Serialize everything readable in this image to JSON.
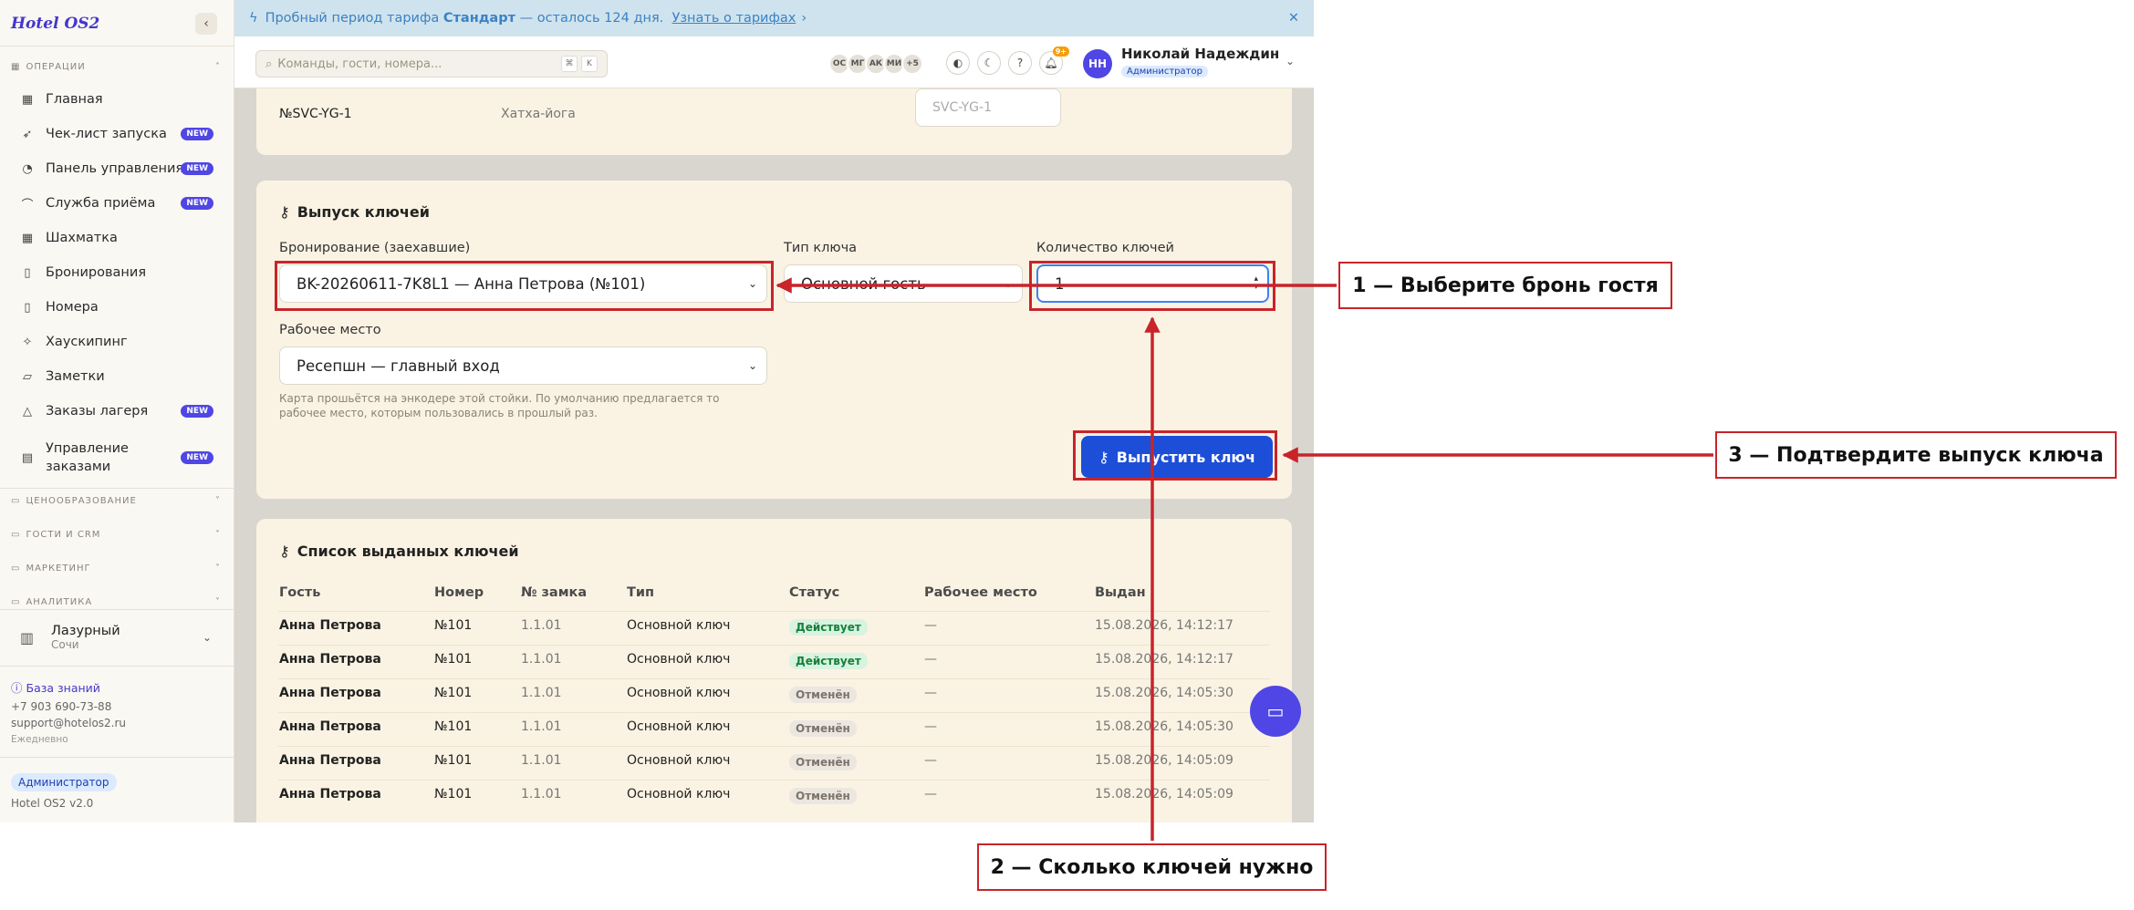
{
  "sidebar": {
    "brand": "Hotel OS2",
    "collapse_icon": "chevron-left-icon",
    "section_operations": "ОПЕРАЦИИ",
    "items": [
      {
        "label": "Главная",
        "icon": "grid-icon",
        "badge": ""
      },
      {
        "label": "Чек-лист запуска",
        "icon": "rocket-icon",
        "badge": "NEW"
      },
      {
        "label": "Панель управления",
        "icon": "gauge-icon",
        "badge": "NEW"
      },
      {
        "label": "Служба приёма",
        "icon": "bell-service-icon",
        "badge": "NEW"
      },
      {
        "label": "Шахматка",
        "icon": "table-icon",
        "badge": ""
      },
      {
        "label": "Бронирования",
        "icon": "document-icon",
        "badge": ""
      },
      {
        "label": "Номера",
        "icon": "door-icon",
        "badge": ""
      },
      {
        "label": "Хаускипинг",
        "icon": "sparkle-icon",
        "badge": ""
      },
      {
        "label": "Заметки",
        "icon": "note-icon",
        "badge": ""
      },
      {
        "label": "Заказы лагеря",
        "icon": "tent-icon",
        "badge": "NEW"
      },
      {
        "label": "Управление заказами",
        "icon": "clipboard-icon",
        "badge": "NEW"
      }
    ],
    "collapsed_sections": [
      "ЦЕНООБРАЗОВАНИЕ",
      "ГОСТИ И CRM",
      "МАРКЕТИНГ",
      "АНАЛИТИКА"
    ],
    "property": {
      "name": "Лазурный",
      "city": "Сочи"
    },
    "knowledge_base": "База знаний",
    "phone": "+7 903 690-73-88",
    "email": "support@hotelos2.ru",
    "schedule": "Ежедневно",
    "role": "Администратор",
    "version": "Hotel OS2 v2.0"
  },
  "banner": {
    "prefix": "Пробный период тарифа",
    "plan": "Стандарт",
    "suffix": "— осталось 124 дня.",
    "link": "Узнать о тарифах"
  },
  "topbar": {
    "search_placeholder": "Команды, гости, номера...",
    "kbd1": "⌘",
    "kbd2": "K",
    "presence": [
      "ОС",
      "МГ",
      "АК",
      "МИ",
      "+5"
    ],
    "notif_count": "9+",
    "user_initials": "НН",
    "user_name": "Николай Надеждин",
    "user_role": "Администратор"
  },
  "service_row": {
    "code": "№SVC-YG-1",
    "name": "Хатха-йога",
    "input_placeholder": "SVC-YG-1"
  },
  "key_issue": {
    "title": "Выпуск ключей",
    "booking_label": "Бронирование (заехавшие)",
    "booking_value": "BK-20260611-7K8L1 — Анна Петрова (№101)",
    "key_type_label": "Тип ключа",
    "key_type_value": "Основной гость",
    "count_label": "Количество ключей",
    "count_value": "1",
    "workplace_label": "Рабочее место",
    "workplace_value": "Ресепшн — главный вход",
    "hint": "Карта прошьётся на энкодере этой стойки. По умолчанию предлагается то рабочее место, которым пользовались в прошлый раз.",
    "button": "Выпустить ключ"
  },
  "issued_keys": {
    "title": "Список выданных ключей",
    "columns": [
      "Гость",
      "Номер",
      "№ замка",
      "Тип",
      "Статус",
      "Рабочее место",
      "Выдан"
    ],
    "rows": [
      {
        "guest": "Анна Петрова",
        "room": "№101",
        "lock": "1.1.01",
        "type": "Основной ключ",
        "status": "Действует",
        "workplace": "—",
        "issued": "15.08.2026, 14:12:17"
      },
      {
        "guest": "Анна Петрова",
        "room": "№101",
        "lock": "1.1.01",
        "type": "Основной ключ",
        "status": "Действует",
        "workplace": "—",
        "issued": "15.08.2026, 14:12:17"
      },
      {
        "guest": "Анна Петрова",
        "room": "№101",
        "lock": "1.1.01",
        "type": "Основной ключ",
        "status": "Отменён",
        "workplace": "—",
        "issued": "15.08.2026, 14:05:30"
      },
      {
        "guest": "Анна Петрова",
        "room": "№101",
        "lock": "1.1.01",
        "type": "Основной ключ",
        "status": "Отменён",
        "workplace": "—",
        "issued": "15.08.2026, 14:05:30"
      },
      {
        "guest": "Анна Петрова",
        "room": "№101",
        "lock": "1.1.01",
        "type": "Основной ключ",
        "status": "Отменён",
        "workplace": "—",
        "issued": "15.08.2026, 14:05:09"
      },
      {
        "guest": "Анна Петрова",
        "room": "№101",
        "lock": "1.1.01",
        "type": "Основной ключ",
        "status": "Отменён",
        "workplace": "—",
        "issued": "15.08.2026, 14:05:09"
      }
    ]
  },
  "annotations": {
    "step1": "1 — Выберите бронь гостя",
    "step2": "2 — Сколько ключей нужно",
    "step3": "3 — Подтвердите выпуск ключа",
    "color": "#c8242a"
  }
}
